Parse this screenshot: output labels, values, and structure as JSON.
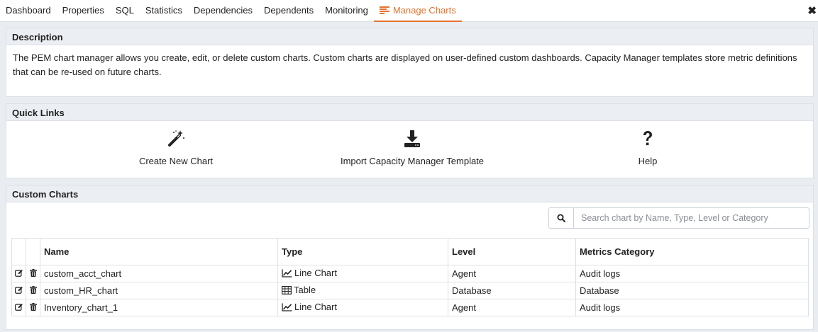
{
  "tabs": [
    {
      "label": "Dashboard"
    },
    {
      "label": "Properties"
    },
    {
      "label": "SQL"
    },
    {
      "label": "Statistics"
    },
    {
      "label": "Dependencies"
    },
    {
      "label": "Dependents"
    },
    {
      "label": "Monitoring"
    },
    {
      "label": "Manage Charts",
      "active": true
    }
  ],
  "close_label": "✖",
  "description": {
    "title": "Description",
    "text": "The PEM chart manager allows you create, edit, or delete custom charts. Custom charts are displayed on user-defined custom dashboards. Capacity Manager templates store metric definitions that can be re-used on future charts."
  },
  "quick_links": {
    "title": "Quick Links",
    "items": [
      {
        "label": "Create New Chart",
        "icon": "magic-wand-icon"
      },
      {
        "label": "Import Capacity Manager Template",
        "icon": "download-icon"
      },
      {
        "label": "Help",
        "icon": "question-icon"
      }
    ]
  },
  "custom_charts": {
    "title": "Custom Charts",
    "search_placeholder": "Search chart by Name, Type, Level or Category",
    "columns": [
      "Name",
      "Type",
      "Level",
      "Metrics Category"
    ],
    "rows": [
      {
        "name": "custom_acct_chart",
        "type": "Line Chart",
        "type_icon": "line-chart-icon",
        "level": "Agent",
        "category": "Audit logs"
      },
      {
        "name": "custom_HR_chart",
        "type": "Table",
        "type_icon": "table-icon",
        "level": "Database",
        "category": "Database"
      },
      {
        "name": "Inventory_chart_1",
        "type": "Line Chart",
        "type_icon": "line-chart-icon",
        "level": "Agent",
        "category": "Audit logs"
      }
    ]
  },
  "colors": {
    "accent": "#e5732d",
    "panel_header": "#ebeef3",
    "border": "#dde0e6"
  }
}
